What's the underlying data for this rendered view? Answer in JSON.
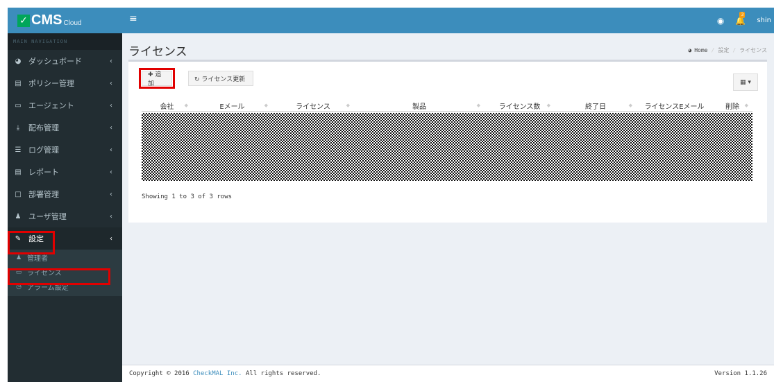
{
  "colors": {
    "brand": "#3c8dbc",
    "sidebar": "#222d32",
    "highlight": "#e10000",
    "check": "#00a65a"
  },
  "logo": {
    "check": "✓",
    "text": "CMS",
    "sub": "Cloud"
  },
  "sidebar": {
    "header": "MAIN NAVIGATION",
    "items": [
      {
        "label": "ダッシュボード",
        "icon": "dashboard-icon",
        "glyph": "◕"
      },
      {
        "label": "ポリシー管理",
        "icon": "list-icon",
        "glyph": "▤"
      },
      {
        "label": "エージェント",
        "icon": "desktop-icon",
        "glyph": "▭"
      },
      {
        "label": "配布管理",
        "icon": "download-icon",
        "glyph": "⤓"
      },
      {
        "label": "ログ管理",
        "icon": "log-icon",
        "glyph": "☰"
      },
      {
        "label": "レポート",
        "icon": "report-icon",
        "glyph": "▤"
      },
      {
        "label": "部署管理",
        "icon": "folder-icon",
        "glyph": "□"
      },
      {
        "label": "ユーザ管理",
        "icon": "user-icon",
        "glyph": "♟"
      },
      {
        "label": "設定",
        "icon": "wrench-icon",
        "glyph": "✎"
      }
    ],
    "chevron": "‹",
    "submenu": [
      {
        "label": "管理者",
        "icon": "admin-icon",
        "glyph": "♟"
      },
      {
        "label": "ライセンス",
        "icon": "card-icon",
        "glyph": "▭"
      },
      {
        "label": "アラーム設定",
        "icon": "clock-icon",
        "glyph": "◷"
      }
    ]
  },
  "topbar": {
    "menu_glyph": "≡",
    "chat_glyph": "◉",
    "bell_glyph": "🔔",
    "bell_badge": "3",
    "user": "shin"
  },
  "page": {
    "title": "ライセンス"
  },
  "breadcrumb": {
    "home_glyph": "◕",
    "home": "Home",
    "level1": "設定",
    "current": "ライセンス",
    "sep": "/"
  },
  "toolbar": {
    "add": "✚ 追加",
    "refresh": "↻ ライセンス更新",
    "columns": "▦ ▾"
  },
  "table": {
    "headers": [
      "会社",
      "Eメール",
      "ライセンス",
      "製品",
      "ライセンス数",
      "終了日",
      "ライセンスEメール",
      "削除"
    ],
    "sort_glyph": "◆"
  },
  "pagination": {
    "info": "Showing 1 to 3 of 3 rows"
  },
  "footer": {
    "prefix": "Copyright © 2016 ",
    "company": "CheckMAL Inc.",
    "suffix": " All rights reserved.",
    "version": "Version 1.1.26"
  }
}
